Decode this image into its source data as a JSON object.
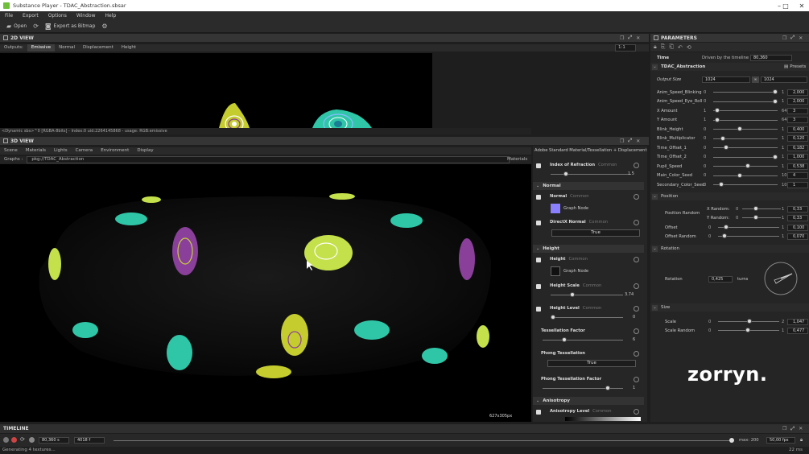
{
  "window": {
    "title": "Substance Player - TDAC_Abstraction.sbsar"
  },
  "menu": [
    "File",
    "Export",
    "Options",
    "Window",
    "Help"
  ],
  "toolbar": {
    "open_label": "Open",
    "export_label": "Export as Bitmap"
  },
  "view2d": {
    "title": "2D VIEW",
    "outputs_label": "Outputs:",
    "tabs": [
      "Emissive",
      "Normal",
      "Displacement",
      "Height"
    ],
    "zoom": "1:1",
    "status": "<Dynamic sbs>^0 [RGBA-8bits] - Index:0 uid:2264145868 - usage: RGB:emissive"
  },
  "view3d": {
    "title": "3D VIEW",
    "tabs": [
      "Scene",
      "Materials",
      "Lights",
      "Camera",
      "Environment",
      "Display"
    ],
    "graphs_label": "Graphs :",
    "graph_path": "pkg://TDAC_Abstraction",
    "materials_label": "Materials",
    "resolution": "627x305px"
  },
  "material_panel": {
    "header": "Adobe Standard Material/Tessellation + Displacement",
    "ior_label": "Index of Refraction",
    "ior_tag": "Common",
    "ior_value": "1.5",
    "sec_normal": "Normal",
    "normal_label": "Normal",
    "normal_tag": "Common",
    "normal_graph": "Graph Node",
    "directx_label": "DirectX Normal",
    "directx_tag": "Common",
    "directx_value": "True",
    "sec_height": "Height",
    "height_label": "Height",
    "height_tag": "Common",
    "height_graph": "Graph Node",
    "height_scale_label": "Height Scale",
    "height_scale_tag": "Common",
    "height_scale_value": "3.74",
    "height_level_label": "Height Level",
    "height_level_tag": "Common",
    "height_level_value": "0",
    "tess_label": "Tessellation Factor",
    "tess_value": "6",
    "phong_label": "Phong Tessellation",
    "phong_value": "True",
    "phong_factor_label": "Phong Tessellation Factor",
    "phong_factor_value": "1",
    "sec_aniso": "Anisotropy",
    "aniso_label": "Anisotropy Level",
    "aniso_tag": "Common"
  },
  "parameters": {
    "title": "PARAMETERS",
    "time_label": "Time",
    "time_driver": "Driven by the timeline",
    "time_value": "80,360",
    "graph_name": "TDAC_Abstraction",
    "presets_label": "Presets",
    "output_size_label": "Output Size",
    "output_size_w": "1024",
    "output_size_h": "1024",
    "rows": [
      {
        "label": "Anim_Speed_Blinking",
        "min": "0",
        "max": "1",
        "value": "2,000",
        "pos": 1.0
      },
      {
        "label": "Anim_Speed_Eye_Roll",
        "min": "0",
        "max": "1",
        "value": "2,000",
        "pos": 1.0
      },
      {
        "label": "X Amount",
        "min": "1",
        "max": "64",
        "value": "3",
        "pos": 0.03
      },
      {
        "label": "Y Amount",
        "min": "1",
        "max": "64",
        "value": "3",
        "pos": 0.03
      },
      {
        "label": "Blink_Height",
        "min": "0",
        "max": "1",
        "value": "0,400",
        "pos": 0.4
      },
      {
        "label": "Blink_Multiplicator",
        "min": "0",
        "max": "1",
        "value": "0,120",
        "pos": 0.12
      },
      {
        "label": "Time_Offset_1",
        "min": "0",
        "max": "1",
        "value": "0,182",
        "pos": 0.18
      },
      {
        "label": "Time_Offset_2",
        "min": "0",
        "max": "1",
        "value": "1,000",
        "pos": 1.0
      },
      {
        "label": "Pupil_Speed",
        "min": "0",
        "max": "1",
        "value": "0,538",
        "pos": 0.54
      },
      {
        "label": "Main_Color_Seed",
        "min": "0",
        "max": "10",
        "value": "4",
        "pos": 0.4
      },
      {
        "label": "Secondary_Color_Seed",
        "min": "0",
        "max": "10",
        "value": "1",
        "pos": 0.1
      }
    ],
    "sec_position": "Position",
    "position_random_label": "Position Random",
    "x_random_label": "X Random:",
    "x_random_min": "0",
    "x_random_max": "1",
    "x_random_value": "0,33",
    "x_random_pos": 0.33,
    "y_random_label": "Y Random:",
    "y_random_min": "0",
    "y_random_max": "1",
    "y_random_value": "0,33",
    "y_random_pos": 0.33,
    "offset_label": "Offset",
    "offset_min": "0",
    "offset_max": "1",
    "offset_value": "0,100",
    "offset_pos": 0.1,
    "offset_random_label": "Offset Random",
    "offset_random_min": "0",
    "offset_random_max": "1",
    "offset_random_value": "0,070",
    "offset_random_pos": 0.07,
    "sec_rotation": "Rotation",
    "rotation_label": "Rotation",
    "rotation_value": "0,425",
    "rotation_unit": "turns",
    "sec_size": "Size",
    "scale_label": "Scale",
    "scale_min": "0",
    "scale_max": "2",
    "scale_value": "1,047",
    "scale_pos": 0.52,
    "scale_random_label": "Scale Random",
    "scale_random_min": "0",
    "scale_random_max": "1",
    "scale_random_value": "0,477",
    "scale_random_pos": 0.48
  },
  "watermark": "zorryn.",
  "timeline": {
    "title": "TIMELINE",
    "time_value": "80,360 s",
    "frame_value": "4018 f",
    "max_label": "max: 200",
    "fps": "50,00 fps"
  },
  "status": {
    "message": "Generating 4 textures...",
    "memory": "22 ms"
  }
}
